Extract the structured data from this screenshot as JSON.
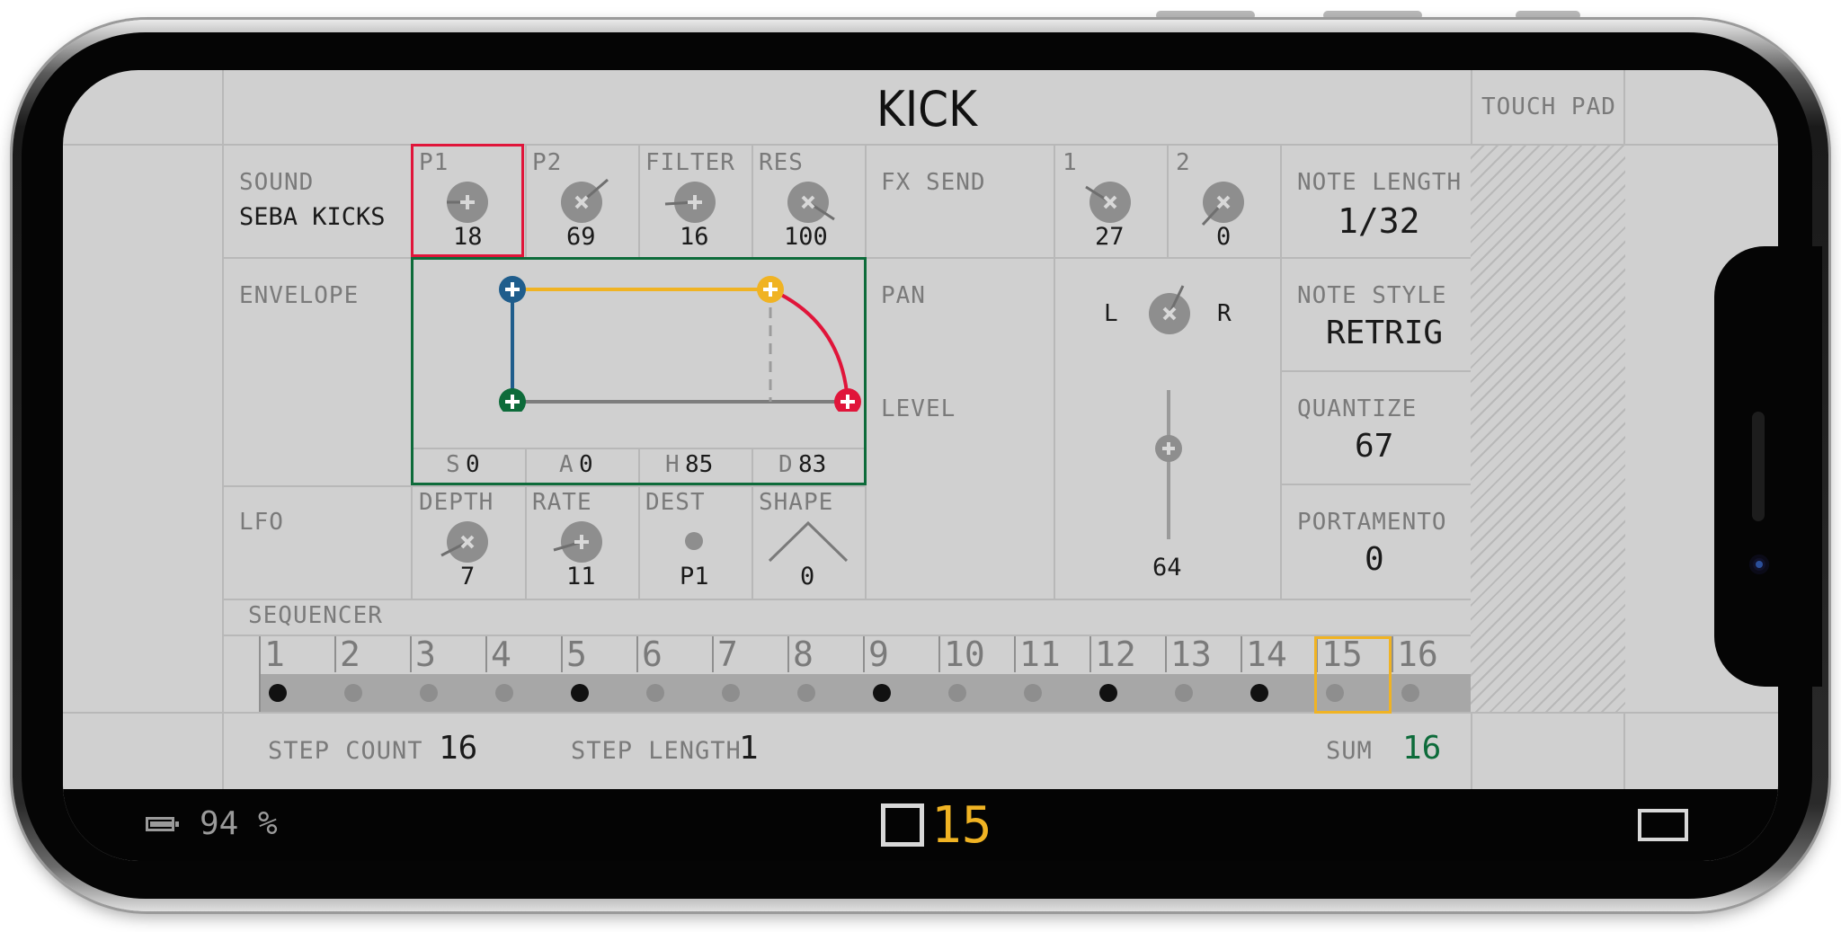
{
  "title": "KICK",
  "touch_pad_label": "TOUCH PAD",
  "sound": {
    "label": "SOUND",
    "value": "SEBA KICKS"
  },
  "p1": {
    "label": "P1",
    "value": "18"
  },
  "p2": {
    "label": "P2",
    "value": "69"
  },
  "filter": {
    "label": "FILTER",
    "value": "16"
  },
  "res": {
    "label": "RES",
    "value": "100"
  },
  "fx_send": {
    "label": "FX SEND",
    "ch1_label": "1",
    "ch1_value": "27",
    "ch2_label": "2",
    "ch2_value": "0"
  },
  "note_length": {
    "label": "NOTE LENGTH",
    "value": "1/32"
  },
  "envelope": {
    "label": "ENVELOPE",
    "s_label": "S",
    "s_value": "0",
    "a_label": "A",
    "a_value": "0",
    "h_label": "H",
    "h_value": "85",
    "d_label": "D",
    "d_value": "83",
    "colors": {
      "start": "#1f5d8c",
      "hold": "#f0b323",
      "decay": "#e0153a",
      "base": "#0d6b3a"
    }
  },
  "pan": {
    "label": "PAN",
    "left": "L",
    "right": "R"
  },
  "level": {
    "label": "LEVEL",
    "value": "64"
  },
  "note_style": {
    "label": "NOTE STYLE",
    "value": "RETRIG"
  },
  "quantize": {
    "label": "QUANTIZE",
    "value": "67"
  },
  "portamento": {
    "label": "PORTAMENTO",
    "value": "0"
  },
  "lfo": {
    "label": "LFO",
    "depth_label": "DEPTH",
    "depth_value": "7",
    "rate_label": "RATE",
    "rate_value": "11",
    "dest_label": "DEST",
    "dest_value": "P1",
    "shape_label": "SHAPE",
    "shape_value": "0"
  },
  "sequencer": {
    "label": "SEQUENCER",
    "steps": [
      "1",
      "2",
      "3",
      "4",
      "5",
      "6",
      "7",
      "8",
      "9",
      "10",
      "11",
      "12",
      "13",
      "14",
      "15",
      "16"
    ],
    "active": [
      true,
      false,
      false,
      false,
      true,
      false,
      false,
      false,
      true,
      false,
      false,
      true,
      false,
      true,
      false,
      false
    ],
    "current_step": 15
  },
  "step_count": {
    "label": "STEP COUNT",
    "value": "16"
  },
  "step_length": {
    "label": "STEP LENGTH",
    "value": "1"
  },
  "sum": {
    "label": "SUM",
    "value": "16"
  },
  "status": {
    "battery": "94 %",
    "current_step_display": "15"
  },
  "colors": {
    "accent": "#f0b323",
    "selected": "#e0153a",
    "envelope_box": "#0d6b3a",
    "sum": "#0d6b3a"
  }
}
